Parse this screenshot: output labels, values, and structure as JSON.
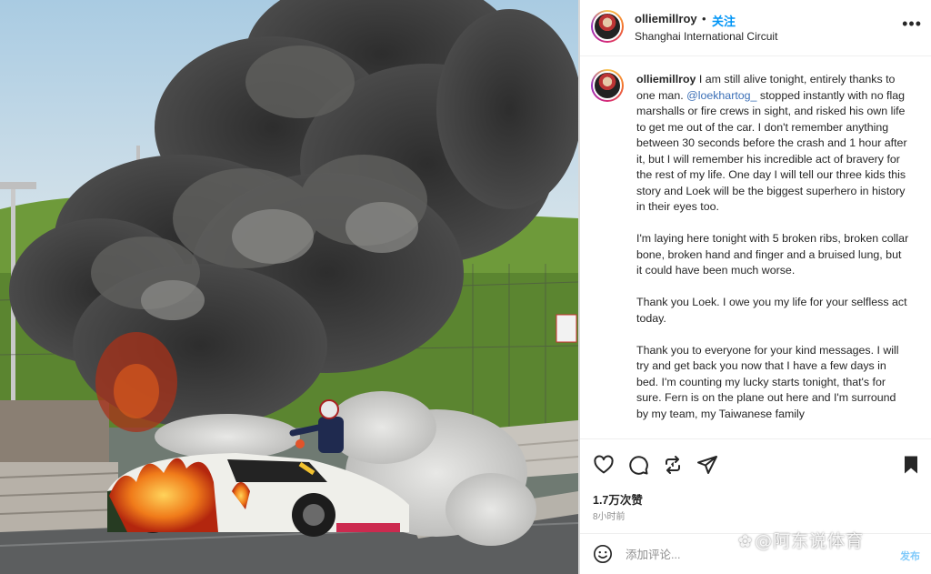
{
  "post": {
    "photo": {
      "description_icon": "race-car-fire-photo"
    },
    "header": {
      "username": "olliemillroy",
      "separator": "•",
      "follow_label": "关注",
      "location": "Shanghai International Circuit",
      "more_label": "•••"
    },
    "caption": {
      "username": "olliemillroy",
      "paragraph1_before": " I am still alive tonight, entirely thanks to one man. ",
      "mention": "@loekhartog_",
      "paragraph1_after": " stopped instantly with no flag marshalls or fire crews in sight, and risked his own life to get me out of the car. I don't remember anything between 30 seconds before the crash and 1 hour after it, but I will remember his incredible act of bravery for the rest of my life. One day I will tell our three kids this story and Loek will be the biggest superhero in history in their eyes too.",
      "paragraph2": "I'm laying here tonight with 5 broken ribs, broken collar bone, broken hand and finger and a bruised lung, but it could have been much worse.",
      "paragraph3": "Thank you Loek. I owe you my life for your selfless act today.",
      "paragraph4": "Thank you to everyone for your kind messages. I will try and get back you now that I have a few days in bed. I'm counting my lucky starts tonight, that's for sure. Fern is on the plane out here and I'm surround by my team, my Taiwanese family"
    },
    "actions": {
      "like_icon": "heart-icon",
      "comment_icon": "comment-icon",
      "repost_icon": "repost-icon",
      "share_icon": "share-icon",
      "save_icon": "bookmark-icon"
    },
    "likes": "1.7万次赞",
    "time": "8小时前",
    "comment": {
      "emoji_icon": "emoji-icon",
      "placeholder": "添加评论...",
      "post_label": "发布"
    },
    "watermark": "@阿东说体育"
  },
  "colors": {
    "link_blue": "#0095f6",
    "mention_blue": "#3b6fb6",
    "text": "#262626",
    "muted": "#8e8e8e"
  }
}
